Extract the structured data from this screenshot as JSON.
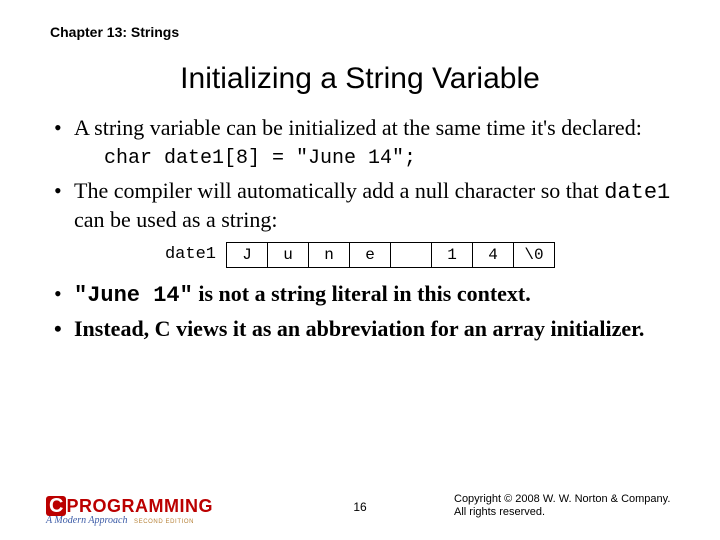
{
  "chapter": "Chapter 13: Strings",
  "title": "Initializing a String Variable",
  "bul1": "A string variable can be initialized at the same time it's declared:",
  "code1": "char date1[8] = \"June 14\";",
  "bul2a": "The compiler will automatically add a null character so that ",
  "bul2_code": "date1",
  "bul2b": " can be used as a string:",
  "array": {
    "label": "date1",
    "cells": [
      "J",
      "u",
      "n",
      "e",
      " ",
      "1",
      "4",
      "\\0"
    ]
  },
  "bul3_code": "\"June 14\"",
  "bul3_rest": " is not a string literal in this context.",
  "bul4": "Instead, C views it as an abbreviation for an array initializer.",
  "footer": {
    "logo_c": "C",
    "logo_word": "PROGRAMMING",
    "logo_sub": "A Modern Approach",
    "logo_ed": "SECOND EDITION",
    "page": "16",
    "copy1": "Copyright © 2008 W. W. Norton & Company.",
    "copy2": "All rights reserved."
  }
}
